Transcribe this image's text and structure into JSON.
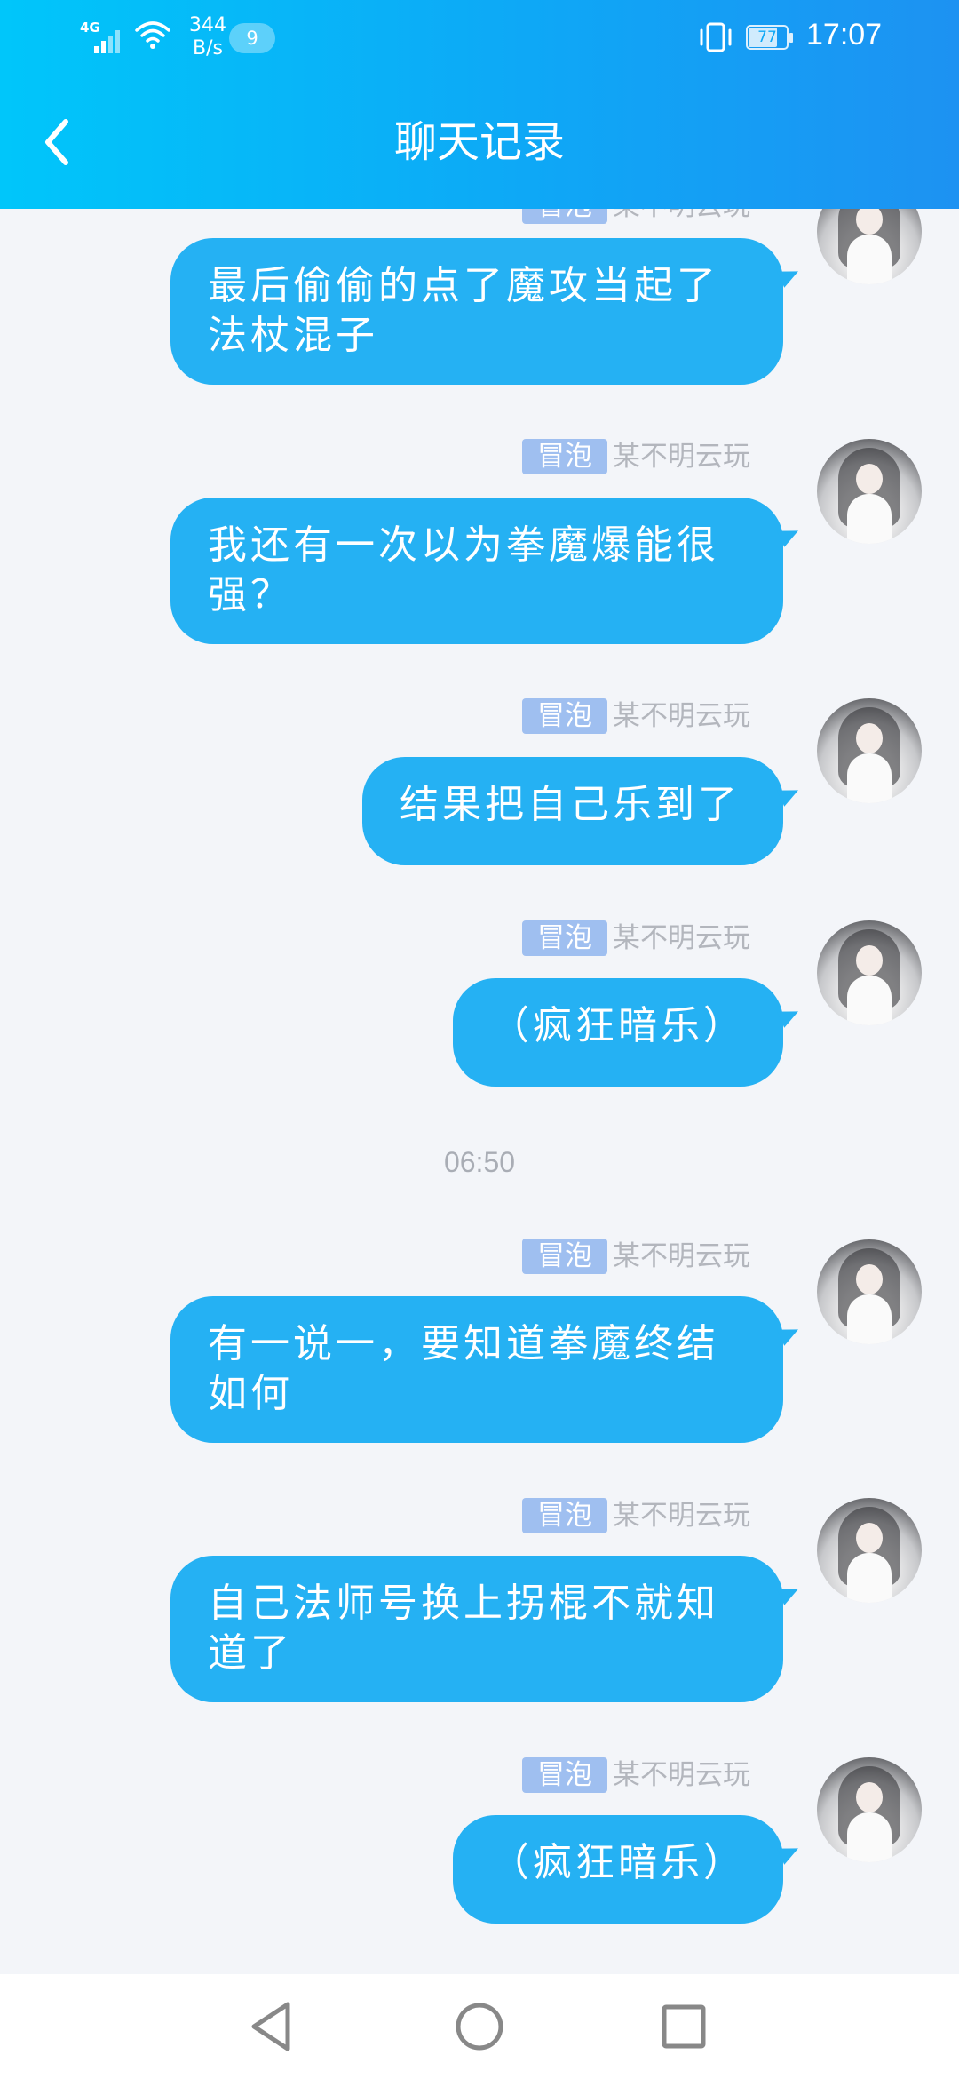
{
  "status_bar": {
    "network": "4G",
    "speed_value": "344",
    "speed_unit": "B/s",
    "notification_count": "9",
    "battery": "77",
    "time": "17:07"
  },
  "header": {
    "title": "聊天记录"
  },
  "messages": [
    {
      "tag": "冒泡",
      "sender": "某不明云玩",
      "text": "最后偷偷的点了魔攻当起了法杖混子"
    },
    {
      "tag": "冒泡",
      "sender": "某不明云玩",
      "text": "我还有一次以为拳魔爆能很强？"
    },
    {
      "tag": "冒泡",
      "sender": "某不明云玩",
      "text": "结果把自己乐到了"
    },
    {
      "tag": "冒泡",
      "sender": "某不明云玩",
      "text": "（疯狂暗乐）"
    },
    {
      "tag": "冒泡",
      "sender": "某不明云玩",
      "text": "有一说一，要知道拳魔终结如何"
    },
    {
      "tag": "冒泡",
      "sender": "某不明云玩",
      "text": "自己法师号换上拐棍不就知道了"
    },
    {
      "tag": "冒泡",
      "sender": "某不明云玩",
      "text": "（疯狂暗乐）"
    }
  ],
  "time_divider": "06:50",
  "navbar": {
    "back": "back-triangle-icon",
    "home": "home-circle-icon",
    "recents": "recents-square-icon"
  },
  "colors": {
    "header_start": "#00c6fa",
    "header_end": "#1d92f2",
    "bubble": "#25b1f3",
    "tag": "#9fbff0",
    "background": "#f3f5f9"
  }
}
